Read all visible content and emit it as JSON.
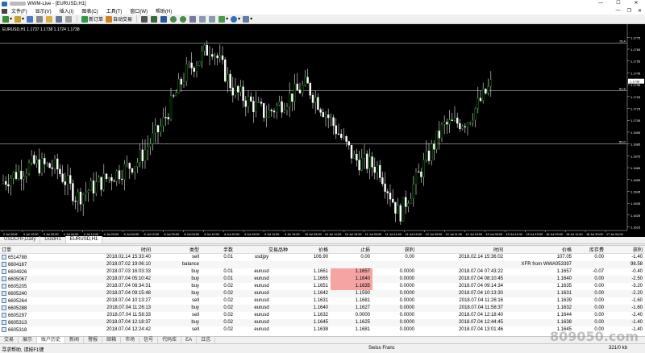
{
  "window": {
    "title": "WWM-Live - [EURUSD,H1]"
  },
  "menu": [
    "文件(F)",
    "显示(V)",
    "插入(I)",
    "图表(C)",
    "工具(T)",
    "窗口(W)",
    "帮助(H)"
  ],
  "toolbar": {
    "new_order": "新订单",
    "autotrade": "自动交易"
  },
  "chart": {
    "header": "EURUSD,H1  1.1737 1.1738 1.1724 1.1738",
    "price_labels": [
      "1.1775",
      "1.1765",
      "1.1755",
      "1.1745",
      "1.1735",
      "1.1725",
      "1.1715",
      "1.1705",
      "1.1695",
      "1.1685",
      "1.1675",
      "1.1665",
      "1.1655",
      "1.1645",
      "1.1635",
      "1.1625",
      "1.1615"
    ],
    "hline_labels": [
      "76.4",
      "61.8",
      "50.0"
    ],
    "current_price": "1.1738",
    "time_labels": [
      "2 Jul 2018",
      "3 Jul 12:00",
      "3 Jul 20:00",
      "4 Jul 04:00",
      "4 Jul 12:00",
      "4 Jul 20:00",
      "5 Jul 04:00",
      "5 Jul 12:00",
      "5 Jul 20:00",
      "6 Jul 04:00",
      "6 Jul 12:00",
      "6 Jul 20:00",
      "9 Jul 03:00",
      "9 Jul 11:00",
      "9 Jul 19:00",
      "10 Jul 03:00",
      "10 Jul 11:00",
      "10 Jul 19:00",
      "11 Jul 03:00",
      "11 Jul 11:00",
      "11 Jul 19:00",
      "12 Jul 03:00",
      "12 Jul 11:00",
      "12 Jul 19:00",
      "13 Jul 03:00",
      "13 Jul 11:00",
      "13 Jul 19:00",
      "16 Jul 03:00",
      "16 Jul 11:00",
      "16 Jul 20:00",
      "17 Jul 04:00"
    ]
  },
  "chart_tabs": [
    "USDCHF,Daily",
    "GoldH1",
    "EURUSD,H1"
  ],
  "terminal": {
    "headers": [
      "订单",
      "时间",
      "类型",
      "手数",
      "交易品种",
      "价格",
      "止损",
      "获利",
      "时间",
      "价格",
      "库存费",
      "获利"
    ],
    "rows": [
      [
        "6514788",
        "2018.02.14 15:33:40",
        "sell",
        "0.01",
        "usdjpy",
        "106.90",
        "0.00",
        "0.00",
        "2018.02.14 15:36:02",
        "107.05",
        "0.00",
        "-1.40"
      ],
      [
        "6604167",
        "2018.07.02 19:06:10",
        "balance",
        "",
        "",
        "",
        "",
        "",
        "",
        "XFR from WWA053397",
        "",
        "98.58"
      ],
      [
        "6604926",
        "2018.07.03 16:03:33",
        "buy",
        "0.01",
        "eurusd",
        "1.1661",
        "1.1657",
        "0.0000",
        "2018.07.04 07:43:22",
        "1.1657",
        "-0.07",
        "-0.40"
      ],
      [
        "6605067",
        "2018.07.04 05:10:42",
        "buy",
        "0.01",
        "eurusd",
        "1.1665",
        "1.1640",
        "0.0000",
        "2018.07.04 08:10:45",
        "1.1640",
        "0.00",
        "-2.50"
      ],
      [
        "6605205",
        "2018.07.04 08:34:31",
        "buy",
        "0.02",
        "eurusd",
        "1.1651",
        "1.1635",
        "0.0000",
        "2018.07.04 09:14:34",
        "1.1635",
        "0.00",
        "-3.20"
      ],
      [
        "6605240",
        "2018.07.04 09:15:48",
        "buy",
        "0.02",
        "eurusd",
        "1.1642",
        "1.1590",
        "0.0000",
        "2018.07.04 10:13:30",
        "1.1631",
        "0.00",
        "-2.20"
      ],
      [
        "6605264",
        "2018.07.04 10:13:27",
        "sell",
        "0.02",
        "eurusd",
        "1.1631",
        "1.1681",
        "0.0000",
        "2018.07.04 11:26:16",
        "1.1639",
        "0.00",
        "-1.60"
      ],
      [
        "6605288",
        "2018.07.04 11:26:13",
        "buy",
        "0.02",
        "eurusd",
        "1.1640",
        "1.1627",
        "0.0000",
        "2018.07.04 11:58:37",
        "1.1632",
        "0.00",
        "-1.60"
      ],
      [
        "6605297",
        "2018.07.04 11:58:33",
        "sell",
        "0.02",
        "eurusd",
        "1.1632",
        "0.0000",
        "0.0000",
        "2018.07.04 12:18:40",
        "1.1644",
        "0.00",
        "-2.40"
      ],
      [
        "6605313",
        "2018.07.04 12:18:37",
        "buy",
        "0.02",
        "eurusd",
        "1.1645",
        "1.1625",
        "0.0000",
        "2018.07.04 12:44:45",
        "1.1638",
        "0.00",
        "-1.40"
      ],
      [
        "6605318",
        "2018.07.04 12:24:42",
        "sell",
        "0.02",
        "eurusd",
        "1.1638",
        "1.1681",
        "0.0000",
        "2018.07.04 13:01:46",
        "1.1645",
        "0.00",
        "-1.40"
      ]
    ]
  },
  "bottom_tabs": [
    "交易",
    "展示",
    "账户历史",
    "新闻",
    "警报",
    "邮箱",
    "市场",
    "信号",
    "代码库",
    "EA",
    "日志"
  ],
  "status": {
    "help": "寻求帮助, 请按F1键",
    "profile": "Swiss Franc",
    "traffic": "321/0 kb"
  },
  "watermark": "809050.com"
}
